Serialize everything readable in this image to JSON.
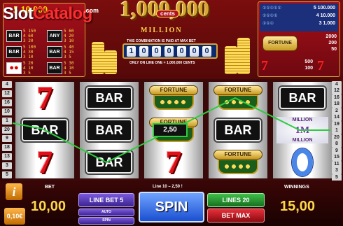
{
  "logo": {
    "slot": "Slot",
    "catalog": "Catalog",
    "com": ".com"
  },
  "jackpot_small": "5 10,000",
  "title": {
    "amount": "1,000,000",
    "cents": "cents",
    "million": "MILLION"
  },
  "combo_text": "THIS COMBINATION IS PAID AT MAX BET",
  "counter_digits": [
    "1",
    "0",
    "0",
    "0",
    "0",
    "0",
    "0"
  ],
  "only_line_text": "ONLY ON LINE ONE = 1,000,000 CENTS",
  "paytable_left": {
    "rows": [
      {
        "symbols": [
          "BAR",
          "ANY"
        ],
        "nums": [
          "5 150",
          "4 60",
          "3 20"
        ],
        "nums2": [
          "5 60",
          "4 20",
          "3 10"
        ]
      },
      {
        "symbols": [
          "BAR",
          "BAR"
        ],
        "nums": [
          "5 100",
          "4 30",
          "3 10"
        ],
        "nums2": [
          "5 40",
          "4 15",
          "3 5"
        ]
      },
      {
        "symbols": [
          "cherries",
          "BAR"
        ],
        "nums": [
          "5 20",
          "4 10",
          "3 5"
        ],
        "nums2": [
          "5 30",
          "4 10",
          "3 5"
        ]
      }
    ]
  },
  "paytable_right": {
    "lines": [
      "5 100.000",
      "4 10.000",
      "3 1.000"
    ],
    "fortune_label": "FORTUNE",
    "fortune_vals": [
      "2000",
      "200",
      "50"
    ],
    "seven_vals": [
      "500",
      "100",
      "20"
    ]
  },
  "line_numbers_left": [
    "4",
    "12",
    "16",
    "10",
    "1",
    "20",
    "9",
    "18",
    "13",
    "3",
    "5"
  ],
  "line_numbers_right": [
    "4",
    "12",
    "16",
    "18",
    "2",
    "14",
    "19",
    "1",
    "20",
    "8",
    "9",
    "15",
    "11",
    "3",
    "5"
  ],
  "reels": [
    [
      "seven",
      "bar",
      "seven"
    ],
    [
      "bar",
      "bar",
      "bar"
    ],
    [
      "fortune",
      "fortune",
      "seven"
    ],
    [
      "fortune",
      "bar",
      "fortune"
    ],
    [
      "bar",
      "million",
      "zero"
    ]
  ],
  "symbol_text": {
    "bar": "BAR",
    "fortune": "FORTUNE",
    "million_top": "MILLION",
    "million_mid": "1M",
    "million_bot": "MILLION"
  },
  "win_amount_label": "2,50",
  "bottom": {
    "bet_label": "BET",
    "bet_value": "10,00",
    "coin_value": "0,10€",
    "info": "i",
    "line_bet_label": "LINE BET 5",
    "auto_label": "AUTO",
    "spin_small_label": "SPIN",
    "line_win_text": "Line 10 – 2,50 !",
    "spin_label": "SPIN",
    "lines_label": "LINES 20",
    "bet_max_label": "BET MAX",
    "winnings_label": "WINNINGS",
    "winnings_value": "15,00"
  },
  "colors": {
    "payline": "#2ecc40",
    "jackpot_gold": "#d8a630",
    "reel_bg": "#ffffff"
  }
}
